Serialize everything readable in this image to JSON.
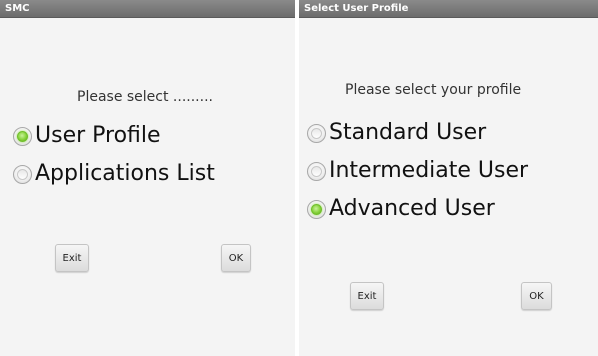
{
  "left_screen": {
    "title": "SMC",
    "prompt": "Please select .........",
    "options": [
      {
        "label": "User Profile",
        "selected": true
      },
      {
        "label": "Applications List",
        "selected": false
      }
    ],
    "buttons": {
      "exit": "Exit",
      "ok": "OK"
    }
  },
  "right_screen": {
    "title": "Select User Profile",
    "prompt": "Please select your profile",
    "options": [
      {
        "label": "Standard User",
        "selected": false
      },
      {
        "label": "Intermediate User",
        "selected": false
      },
      {
        "label": "Advanced User",
        "selected": true
      }
    ],
    "buttons": {
      "exit": "Exit",
      "ok": "OK"
    }
  },
  "colors": {
    "titlebar": "#6c6c6c",
    "background": "#f4f4f4",
    "radio_selected": "#87d33c"
  }
}
